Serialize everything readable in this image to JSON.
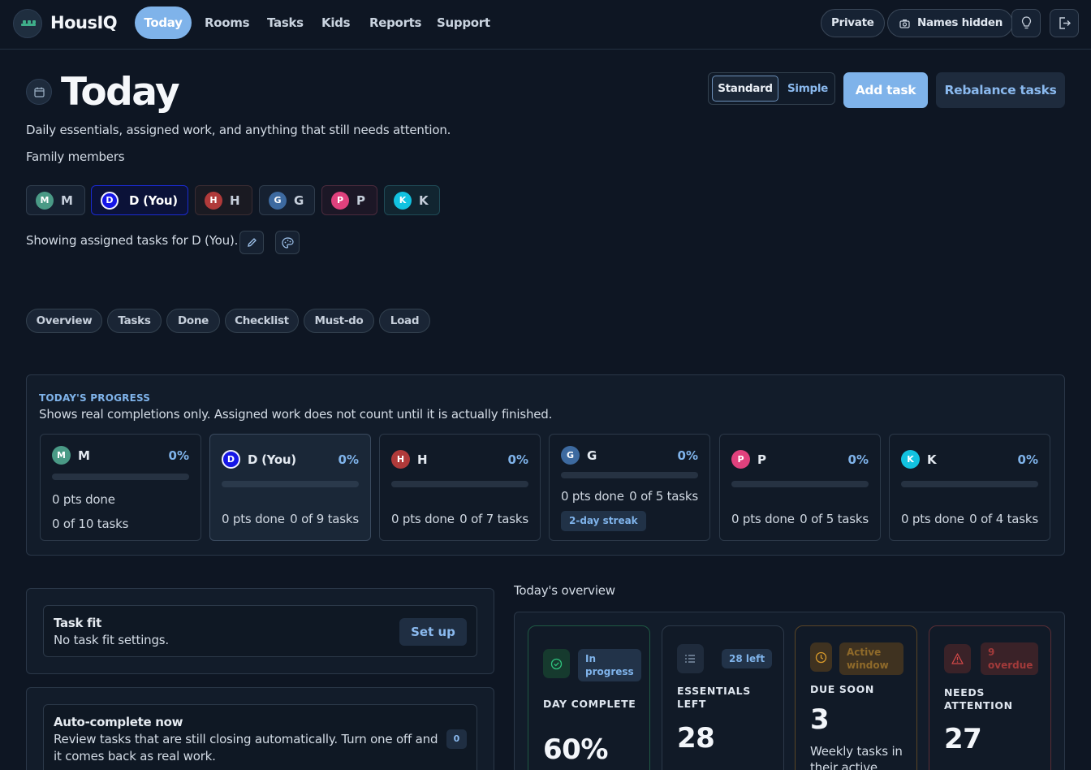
{
  "app": {
    "name": "HousIQ"
  },
  "nav": {
    "items": [
      {
        "label": "Today",
        "active": true
      },
      {
        "label": "Rooms",
        "active": false
      },
      {
        "label": "Tasks",
        "active": false
      },
      {
        "label": "Kids",
        "active": false
      },
      {
        "label": "Reports",
        "active": false
      },
      {
        "label": "Support",
        "active": false
      }
    ],
    "private_label": "Private",
    "names_hidden_label": "Names hidden",
    "icons": {
      "names_hidden": "camera-icon",
      "tip": "lightbulb-icon",
      "logout": "logout-icon"
    }
  },
  "header": {
    "title": "Today",
    "subtitle": "Daily essentials, assigned work, and anything that still needs attention.",
    "view_toggle": {
      "options": [
        "Standard",
        "Simple"
      ],
      "selected": "Standard"
    },
    "add_task_label": "Add task",
    "rebalance_label": "Rebalance tasks"
  },
  "members": {
    "label": "Family members",
    "items": [
      {
        "initial": "M",
        "name": "M",
        "color": "#4a9a86",
        "selected": false
      },
      {
        "initial": "D",
        "name": "D (You)",
        "color": "#1515e6",
        "selected": true
      },
      {
        "initial": "H",
        "name": "H",
        "color": "#b03a3a",
        "selected": false
      },
      {
        "initial": "G",
        "name": "G",
        "color": "#3d6aa0",
        "selected": false
      },
      {
        "initial": "P",
        "name": "P",
        "color": "#e0417d",
        "selected": false
      },
      {
        "initial": "K",
        "name": "K",
        "color": "#12c2e0",
        "selected": false
      }
    ],
    "showing_text": "Showing assigned tasks for D (You)."
  },
  "tabs": [
    "Overview",
    "Tasks",
    "Done",
    "Checklist",
    "Must-do",
    "Load"
  ],
  "progress": {
    "title": "TODAY'S PROGRESS",
    "subtitle": "Shows real completions only. Assigned work does not count until it is actually finished.",
    "cards": [
      {
        "initial": "M",
        "name": "M",
        "percent": "0%",
        "fill": 0,
        "pts": "0 pts done",
        "tasks": "0 of 10 tasks"
      },
      {
        "initial": "D",
        "name": "D (You)",
        "percent": "0%",
        "fill": 0,
        "pts": "0 pts done",
        "tasks": "0 of 9 tasks"
      },
      {
        "initial": "H",
        "name": "H",
        "percent": "0%",
        "fill": 0,
        "pts": "0 pts done",
        "tasks": "0 of 7 tasks"
      },
      {
        "initial": "G",
        "name": "G",
        "percent": "0%",
        "fill": 0,
        "pts": "0 pts done",
        "tasks": "0 of 5 tasks",
        "streak": "2-day streak"
      },
      {
        "initial": "P",
        "name": "P",
        "percent": "0%",
        "fill": 0,
        "pts": "0 pts done",
        "tasks": "0 of 5 tasks"
      },
      {
        "initial": "K",
        "name": "K",
        "percent": "0%",
        "fill": 0,
        "pts": "0 pts done",
        "tasks": "0 of 4 tasks"
      }
    ]
  },
  "task_fit": {
    "title": "Task fit",
    "text": "No task fit settings.",
    "button_label": "Set up"
  },
  "auto_complete": {
    "title": "Auto-complete now",
    "text": "Review tasks that are still closing automatically. Turn one off and it comes back as real work.",
    "count": "0"
  },
  "overview": {
    "label": "Today's overview",
    "cards": [
      {
        "badge": "In progress",
        "label": "DAY COMPLETE",
        "value": "60%",
        "icon": "check-circle-icon",
        "accent": "#2e9e6a"
      },
      {
        "badge": "28 left",
        "label": "ESSENTIALS LEFT",
        "value": "28",
        "icon": "list-icon",
        "accent": "#7fb3ea"
      },
      {
        "badge": "Active window",
        "label": "DUE SOON",
        "value": "3",
        "desc": "Weekly tasks in their active window",
        "icon": "clock-icon",
        "accent": "#d89a2a"
      },
      {
        "badge": "9 overdue",
        "label": "NEEDS ATTENTION",
        "value": "27",
        "icon": "warning-icon",
        "accent": "#d04848"
      }
    ]
  }
}
